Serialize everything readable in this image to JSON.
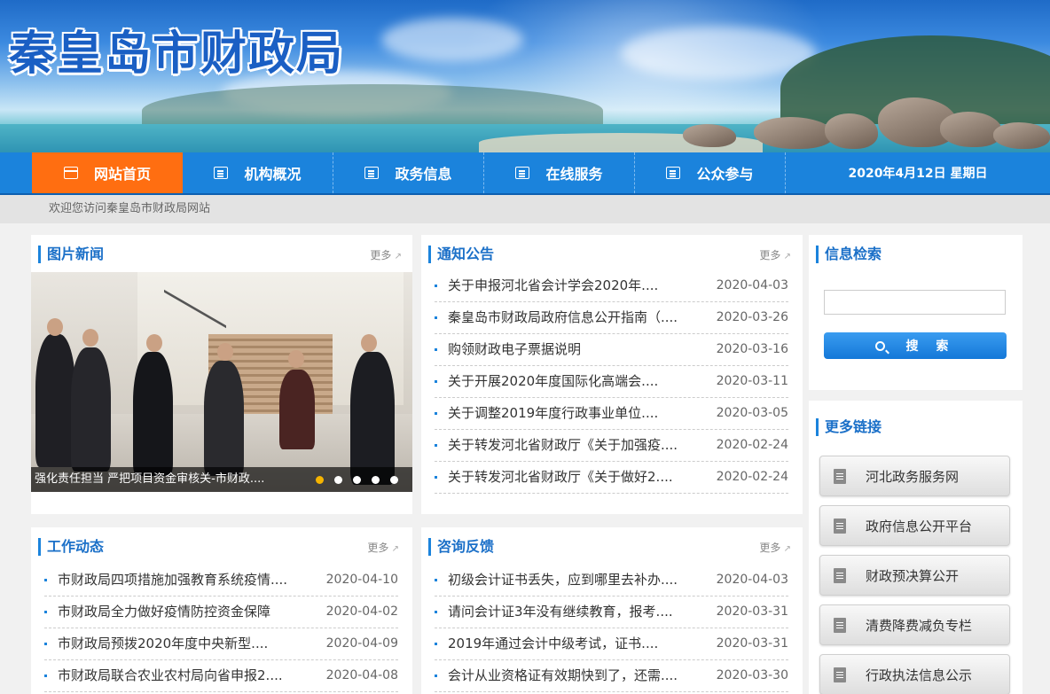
{
  "site": {
    "title": "秦皇岛市财政局"
  },
  "nav": {
    "items": [
      {
        "label": "网站首页",
        "active": true
      },
      {
        "label": "机构概况"
      },
      {
        "label": "政务信息"
      },
      {
        "label": "在线服务"
      },
      {
        "label": "公众参与"
      }
    ],
    "date": "2020年4月12日  星期日"
  },
  "welcome": "欢迎您访问秦皇岛市财政局网站",
  "photo_news": {
    "title": "图片新闻",
    "more": "更多",
    "caption": "强化责任担当 严把项目资金审核关-市财政...."
  },
  "notices": {
    "title": "通知公告",
    "more": "更多",
    "items": [
      {
        "title": "关于申报河北省会计学会2020年....",
        "date": "2020-04-03"
      },
      {
        "title": "秦皇岛市财政局政府信息公开指南（....",
        "date": "2020-03-26"
      },
      {
        "title": "购领财政电子票据说明",
        "date": "2020-03-16"
      },
      {
        "title": "关于开展2020年度国际化高端会....",
        "date": "2020-03-11"
      },
      {
        "title": "关于调整2019年度行政事业单位....",
        "date": "2020-03-05"
      },
      {
        "title": "关于转发河北省财政厅《关于加强疫....",
        "date": "2020-02-24"
      },
      {
        "title": "关于转发河北省财政厅《关于做好2....",
        "date": "2020-02-24"
      }
    ]
  },
  "search": {
    "title": "信息检索",
    "input_value": "",
    "button_label": "搜 索"
  },
  "work": {
    "title": "工作动态",
    "more": "更多",
    "items": [
      {
        "title": "市财政局四项措施加强教育系统疫情....",
        "date": "2020-04-10"
      },
      {
        "title": "市财政局全力做好疫情防控资金保障",
        "date": "2020-04-02"
      },
      {
        "title": "市财政局预拨2020年度中央新型....",
        "date": "2020-04-09"
      },
      {
        "title": "市财政局联合农业农村局向省申报2....",
        "date": "2020-04-08"
      }
    ]
  },
  "consult": {
    "title": "咨询反馈",
    "more": "更多",
    "items": [
      {
        "title": "初级会计证书丢失，应到哪里去补办....",
        "date": "2020-04-03"
      },
      {
        "title": "请问会计证3年没有继续教育，报考....",
        "date": "2020-03-31"
      },
      {
        "title": "2019年通过会计中级考试，证书....",
        "date": "2020-03-31"
      },
      {
        "title": "会计从业资格证有效期快到了，还需....",
        "date": "2020-03-30"
      }
    ]
  },
  "links": {
    "title": "更多链接",
    "items": [
      {
        "label": "河北政务服务网",
        "icon": "document-icon"
      },
      {
        "label": "政府信息公开平台",
        "icon": "document-icon"
      },
      {
        "label": "财政预决算公开",
        "icon": "edit-icon"
      },
      {
        "label": "清费降费减负专栏",
        "icon": "book-icon"
      },
      {
        "label": "行政执法信息公示",
        "icon": "clipboard-icon"
      }
    ]
  }
}
